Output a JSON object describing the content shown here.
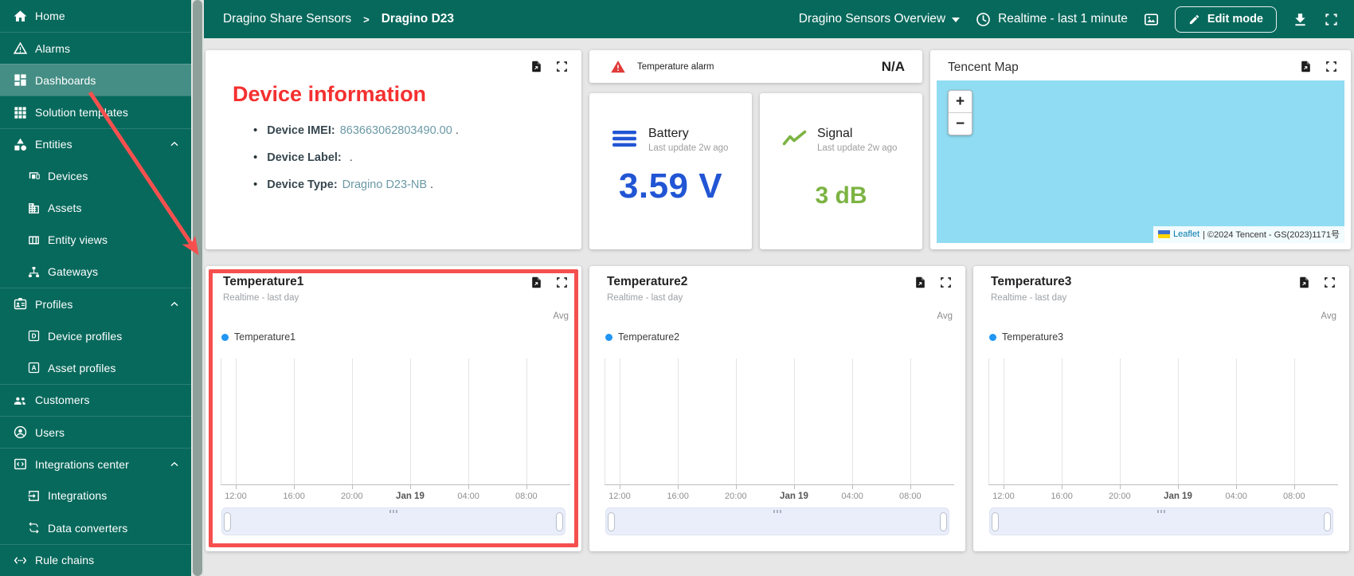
{
  "colors": {
    "sidebar_teal": "#07695c",
    "annotation_red": "#f5504e",
    "device_title_red": "#f53030",
    "battery_blue": "#2155d4",
    "signal_green": "#7cb342",
    "legend_blue": "#2196f3",
    "map_water_blue": "#90dcf2"
  },
  "sidebar": {
    "items": [
      {
        "label": "Home",
        "icon": "home-icon",
        "level": 1
      },
      {
        "label": "Alarms",
        "icon": "alarms-icon",
        "level": 1,
        "divider": true
      },
      {
        "label": "Dashboards",
        "icon": "dashboards-icon",
        "level": 1,
        "divider": true,
        "selected": true
      },
      {
        "label": "Solution templates",
        "icon": "solution-templates-icon",
        "level": 1,
        "divider": true
      },
      {
        "label": "Entities",
        "icon": "entities-icon",
        "level": 1,
        "divider": true,
        "expandable": true
      },
      {
        "label": "Devices",
        "icon": "devices-icon",
        "level": 2
      },
      {
        "label": "Assets",
        "icon": "assets-icon",
        "level": 2
      },
      {
        "label": "Entity views",
        "icon": "entity-views-icon",
        "level": 2
      },
      {
        "label": "Gateways",
        "icon": "gateways-icon",
        "level": 2
      },
      {
        "label": "Profiles",
        "icon": "profiles-icon",
        "level": 1,
        "divider": true,
        "expandable": true
      },
      {
        "label": "Device profiles",
        "icon": "device-profiles-icon",
        "level": 2
      },
      {
        "label": "Asset profiles",
        "icon": "asset-profiles-icon",
        "level": 2
      },
      {
        "label": "Customers",
        "icon": "customers-icon",
        "level": 1,
        "divider": true
      },
      {
        "label": "Users",
        "icon": "users-icon",
        "level": 1,
        "divider": true
      },
      {
        "label": "Integrations center",
        "icon": "integrations-center-icon",
        "level": 1,
        "divider": true,
        "expandable": true
      },
      {
        "label": "Integrations",
        "icon": "integrations-icon",
        "level": 2
      },
      {
        "label": "Data converters",
        "icon": "data-converters-icon",
        "level": 2
      },
      {
        "label": "Rule chains",
        "icon": "rule-chains-icon",
        "level": 1,
        "divider": true
      }
    ]
  },
  "header": {
    "breadcrumb_parent": "Dragino Share Sensors",
    "breadcrumb_sep": ">",
    "breadcrumb_current": "Dragino D23",
    "dashboard_select": "Dragino Sensors Overview",
    "timewindow": "Realtime - last 1 minute",
    "edit_mode": "Edit mode"
  },
  "cards": {
    "device_info": {
      "title": "Device information",
      "bullets": [
        {
          "label": "Device IMEI:",
          "value": "863663062803490.00",
          "suffix": "."
        },
        {
          "label": "Device Label:",
          "value": "",
          "suffix": "."
        },
        {
          "label": "Device Type:",
          "value": "Dragino D23-NB",
          "suffix": "."
        }
      ]
    },
    "alarm": {
      "label": "Temperature alarm",
      "value": "N/A"
    },
    "battery": {
      "title": "Battery",
      "subtitle": "Last update 2w ago",
      "value": "3.59 V",
      "color": "#2155d4"
    },
    "signal": {
      "title": "Signal",
      "subtitle": "Last update 2w ago",
      "value": "3 dB",
      "color": "#7cb342"
    },
    "map": {
      "title": "Tencent Map",
      "zoom_in": "+",
      "zoom_out": "−",
      "attribution_link": "Leaflet",
      "attribution_rest": " | ©2024 Tencent - GS(2023)1171号"
    }
  },
  "annotation": {
    "type": "red arrow from Dashboards menu item to highlighted Temperature1 card",
    "color": "#f5504e"
  },
  "chart_data": [
    {
      "type": "line",
      "title": "Temperature1",
      "subtitle": "Realtime - last day",
      "aggregation_label": "Avg",
      "legend": [
        {
          "label": "Temperature1",
          "color": "#2196f3"
        }
      ],
      "x_ticks": [
        "12:00",
        "16:00",
        "20:00",
        "Jan 19",
        "04:00",
        "08:00"
      ],
      "x_tick_bold_index": 3,
      "x_tick_pcts": [
        4.1,
        20.8,
        37.4,
        54.1,
        70.8,
        87.4
      ],
      "series": [
        {
          "name": "Temperature1",
          "points": []
        }
      ],
      "grid": "vertical-only",
      "annotated": true
    },
    {
      "type": "line",
      "title": "Temperature2",
      "subtitle": "Realtime - last day",
      "aggregation_label": "Avg",
      "legend": [
        {
          "label": "Temperature2",
          "color": "#2196f3"
        }
      ],
      "x_ticks": [
        "12:00",
        "16:00",
        "20:00",
        "Jan 19",
        "04:00",
        "08:00"
      ],
      "x_tick_bold_index": 3,
      "x_tick_pcts": [
        4.1,
        20.8,
        37.4,
        54.1,
        70.8,
        87.4
      ],
      "series": [
        {
          "name": "Temperature2",
          "points": []
        }
      ],
      "grid": "vertical-only",
      "annotated": false
    },
    {
      "type": "line",
      "title": "Temperature3",
      "subtitle": "Realtime - last day",
      "aggregation_label": "Avg",
      "legend": [
        {
          "label": "Temperature3",
          "color": "#2196f3"
        }
      ],
      "x_ticks": [
        "12:00",
        "16:00",
        "20:00",
        "Jan 19",
        "04:00",
        "08:00"
      ],
      "x_tick_bold_index": 3,
      "x_tick_pcts": [
        4.1,
        20.8,
        37.4,
        54.1,
        70.8,
        87.4
      ],
      "series": [
        {
          "name": "Temperature3",
          "points": []
        }
      ],
      "grid": "vertical-only",
      "annotated": false
    }
  ],
  "temp_card_lefts": [
    258,
    740,
    1222
  ]
}
